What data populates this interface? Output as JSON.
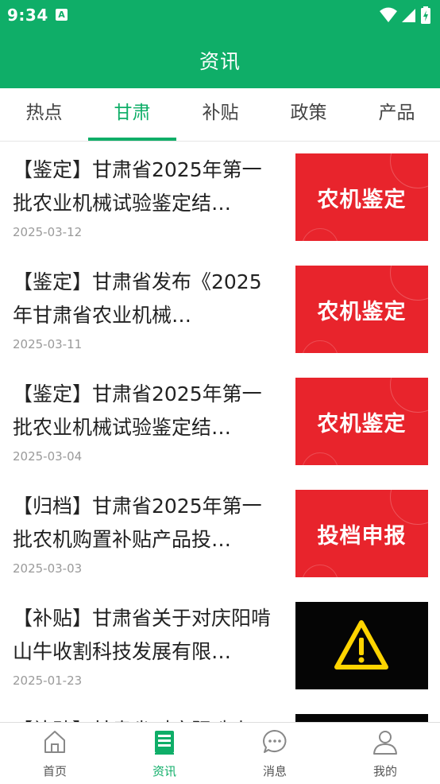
{
  "status_bar": {
    "time": "9:34",
    "notification_icon": "A"
  },
  "app_bar": {
    "title": "资讯"
  },
  "tabs": [
    {
      "label": "热点",
      "active": false
    },
    {
      "label": "甘肃",
      "active": true
    },
    {
      "label": "补贴",
      "active": false
    },
    {
      "label": "政策",
      "active": false
    },
    {
      "label": "产品",
      "active": false
    }
  ],
  "news": [
    {
      "title": "【鉴定】甘肃省2025年第一批农业机械试验鉴定结…",
      "date": "2025-03-12",
      "thumb_text": "农机鉴定",
      "thumb_color": "#e8242c"
    },
    {
      "title": "【鉴定】甘肃省发布《2025年甘肃省农业机械…",
      "date": "2025-03-11",
      "thumb_text": "农机鉴定",
      "thumb_color": "#e8242c"
    },
    {
      "title": "【鉴定】甘肃省2025年第一批农业机械试验鉴定结…",
      "date": "2025-03-04",
      "thumb_text": "农机鉴定",
      "thumb_color": "#e8242c"
    },
    {
      "title": "【归档】甘肃省2025年第一批农机购置补贴产品投…",
      "date": "2025-03-03",
      "thumb_text": "投档申报",
      "thumb_color": "#e8242c"
    },
    {
      "title": "【补贴】甘肃省关于对庆阳啃山牛收割科技发展有限…",
      "date": "2025-01-23",
      "thumb_text": "",
      "thumb_icon": "warning-icon",
      "thumb_color": "#050505"
    },
    {
      "title": "【补贴】甘肃省对庆阳啃山",
      "date": "",
      "thumb_text": "",
      "thumb_color": "#050505"
    }
  ],
  "bottom_nav": [
    {
      "label": "首页",
      "icon": "home-icon",
      "active": false
    },
    {
      "label": "资讯",
      "icon": "news-icon",
      "active": true
    },
    {
      "label": "消息",
      "icon": "chat-icon",
      "active": false
    },
    {
      "label": "我的",
      "icon": "user-icon",
      "active": false
    }
  ],
  "colors": {
    "primary": "#0fae68",
    "thumb_red": "#e8242c",
    "warning_yellow": "#ffd400"
  }
}
